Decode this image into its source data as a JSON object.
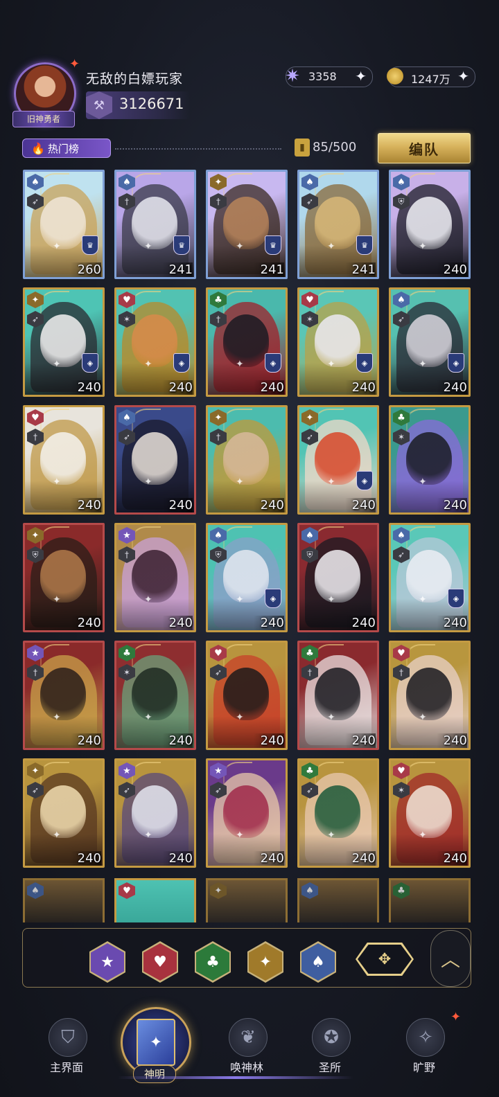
{
  "header": {
    "player_name": "无敌的白嫖玩家",
    "avatar_title": "旧神勇者",
    "power": "3126671",
    "resources": [
      {
        "name": "crystal",
        "icon": "crystal-star-icon",
        "value": "3358"
      },
      {
        "name": "gold",
        "icon": "gold-coin-icon",
        "value": "1247万"
      }
    ]
  },
  "toolbar": {
    "hot_tab_label": "热门榜",
    "count": "85/500",
    "team_button_label": "编队"
  },
  "cards": [
    {
      "level": "260",
      "suit": "spade",
      "role": "arrow",
      "badge": "crown",
      "frame": "blue",
      "palette": [
        "#bfe2ef",
        "#f0e6d8",
        "#c9a35a"
      ]
    },
    {
      "level": "241",
      "suit": "spade",
      "role": "sword",
      "badge": "crown",
      "frame": "blue",
      "palette": [
        "#b9a6e8",
        "#e8e8f0",
        "#3a3a48"
      ]
    },
    {
      "level": "241",
      "suit": "diamond",
      "role": "sword",
      "badge": "crown",
      "frame": "blue",
      "palette": [
        "#c8b8f0",
        "#b8845a",
        "#3a2a22"
      ]
    },
    {
      "level": "241",
      "suit": "spade",
      "role": "arrow",
      "badge": "crown",
      "frame": "blue",
      "palette": [
        "#b0d8ec",
        "#d8b878",
        "#8a6a3a"
      ]
    },
    {
      "level": "240",
      "suit": "spade",
      "role": "shield",
      "badge": "",
      "frame": "blue",
      "palette": [
        "#c8b0e8",
        "#f0f0f6",
        "#1e1e28"
      ]
    },
    {
      "level": "240",
      "suit": "diamond",
      "role": "arrow",
      "badge": "shield",
      "frame": "teal",
      "palette": [
        "#4ec4b4",
        "#f2f0f0",
        "#2a2a30"
      ]
    },
    {
      "level": "240",
      "suit": "heart",
      "role": "star",
      "badge": "shield",
      "frame": "teal",
      "palette": [
        "#52c2b2",
        "#d88a4a",
        "#b88a2a"
      ]
    },
    {
      "level": "240",
      "suit": "club",
      "role": "sword",
      "badge": "shield",
      "frame": "teal",
      "palette": [
        "#4ab8ac",
        "#1a1a22",
        "#a0202a"
      ]
    },
    {
      "level": "240",
      "suit": "heart",
      "role": "star",
      "badge": "shield",
      "frame": "teal",
      "palette": [
        "#5ac6b6",
        "#eceaf2",
        "#b8a24a"
      ]
    },
    {
      "level": "240",
      "suit": "spade",
      "role": "arrow",
      "badge": "shield",
      "frame": "teal",
      "palette": [
        "#56c0b0",
        "#d8d4dc",
        "#2a2a34"
      ]
    },
    {
      "level": "240",
      "suit": "heart",
      "role": "sword",
      "badge": "",
      "frame": "gold",
      "palette": [
        "#e8e4dc",
        "#f4f2ee",
        "#c09a4a"
      ]
    },
    {
      "level": "240",
      "suit": "spade",
      "role": "arrow",
      "badge": "",
      "frame": "red",
      "palette": [
        "#3a4a8a",
        "#e8e0d8",
        "#1a1a2a"
      ]
    },
    {
      "level": "240",
      "suit": "diamond",
      "role": "sword",
      "badge": "",
      "frame": "teal",
      "palette": [
        "#4cbcae",
        "#d8b89a",
        "#c09a3a"
      ]
    },
    {
      "level": "240",
      "suit": "diamond",
      "role": "arrow",
      "badge": "shield",
      "frame": "teal",
      "palette": [
        "#52c4b4",
        "#d8482a",
        "#f0d8c8"
      ]
    },
    {
      "level": "240",
      "suit": "club",
      "role": "star",
      "badge": "",
      "frame": "teal",
      "palette": [
        "#3a9a8e",
        "#1a1c24",
        "#8a6ad8"
      ]
    },
    {
      "level": "240",
      "suit": "diamond",
      "role": "shield",
      "badge": "",
      "frame": "red",
      "palette": [
        "#8a2a2a",
        "#b07a4a",
        "#2a1e18"
      ]
    },
    {
      "level": "240",
      "suit": "star",
      "role": "sword",
      "badge": "",
      "frame": "gold",
      "palette": [
        "#b08a4a",
        "#3a2030",
        "#c8a0d8"
      ]
    },
    {
      "level": "240",
      "suit": "spade",
      "role": "shield",
      "badge": "shield",
      "frame": "teal",
      "palette": [
        "#4ec2b2",
        "#e4e8f0",
        "#8aa0c8"
      ]
    },
    {
      "level": "240",
      "suit": "spade",
      "role": "shield",
      "badge": "",
      "frame": "red",
      "palette": [
        "#8a2a30",
        "#f0eef2",
        "#1a1a22"
      ]
    },
    {
      "level": "240",
      "suit": "spade",
      "role": "arrow",
      "badge": "shield",
      "frame": "teal",
      "palette": [
        "#5ac8b8",
        "#eceef4",
        "#b8c8d8"
      ]
    },
    {
      "level": "240",
      "suit": "star",
      "role": "sword",
      "badge": "",
      "frame": "red",
      "palette": [
        "#8a2a2a",
        "#2a1e1a",
        "#c8a24a"
      ]
    },
    {
      "level": "240",
      "suit": "club",
      "role": "star",
      "badge": "",
      "frame": "red",
      "palette": [
        "#8e2e30",
        "#1e2a22",
        "#6aa07a"
      ]
    },
    {
      "level": "240",
      "suit": "heart",
      "role": "arrow",
      "badge": "",
      "frame": "gold",
      "palette": [
        "#b8943e",
        "#1e1a1a",
        "#c8402a"
      ]
    },
    {
      "level": "240",
      "suit": "club",
      "role": "sword",
      "badge": "",
      "frame": "red",
      "palette": [
        "#8a2a2e",
        "#1a1a20",
        "#e8e0e0"
      ]
    },
    {
      "level": "240",
      "suit": "heart",
      "role": "sword",
      "badge": "",
      "frame": "gold",
      "palette": [
        "#b8963e",
        "#1a1a20",
        "#e8d0c8"
      ]
    },
    {
      "level": "240",
      "suit": "diamond",
      "role": "arrow",
      "badge": "",
      "frame": "gold",
      "palette": [
        "#b8943e",
        "#f0dcb0",
        "#5a3a22"
      ]
    },
    {
      "level": "240",
      "suit": "star",
      "role": "arrow",
      "badge": "",
      "frame": "gold",
      "palette": [
        "#b8943e",
        "#e4e6f0",
        "#5a4a7a"
      ]
    },
    {
      "level": "240",
      "suit": "star",
      "role": "arrow",
      "badge": "",
      "frame": "gold",
      "palette": [
        "#6a3a8a",
        "#a02a4a",
        "#e8c8a8"
      ]
    },
    {
      "level": "240",
      "suit": "club",
      "role": "arrow",
      "badge": "",
      "frame": "gold",
      "palette": [
        "#b8943e",
        "#1e5a3a",
        "#e8c8b0"
      ]
    },
    {
      "level": "240",
      "suit": "heart",
      "role": "star",
      "badge": "",
      "frame": "gold",
      "palette": [
        "#b8943e",
        "#f0e4d8",
        "#a02a2a"
      ]
    }
  ],
  "partial_cards": [
    {
      "suit": "spade",
      "frame": "gold"
    },
    {
      "suit": "heart",
      "frame": "teal"
    },
    {
      "suit": "diamond",
      "frame": "gold"
    },
    {
      "suit": "spade",
      "frame": "gold"
    },
    {
      "suit": "club",
      "frame": "gold"
    }
  ],
  "filters": [
    {
      "name": "star",
      "icon": "star-suit-icon",
      "color": "#6a4ab0"
    },
    {
      "name": "heart",
      "icon": "heart-suit-icon",
      "color": "#a8323e"
    },
    {
      "name": "club",
      "icon": "club-suit-icon",
      "color": "#2c7a3a"
    },
    {
      "name": "diamond",
      "icon": "diamond-suit-icon",
      "color": "#a07a2a"
    },
    {
      "name": "spade",
      "icon": "spade-suit-icon",
      "color": "#3f5ea0"
    }
  ],
  "nav": {
    "items": [
      {
        "label": "主界面",
        "icon": "main-emblem-icon"
      },
      {
        "label": "神明",
        "icon": "card-book-icon",
        "active": true
      },
      {
        "label": "唤神林",
        "icon": "tree-icon"
      },
      {
        "label": "圣所",
        "icon": "sanctuary-icon"
      },
      {
        "label": "旷野",
        "icon": "compass-icon"
      }
    ]
  }
}
